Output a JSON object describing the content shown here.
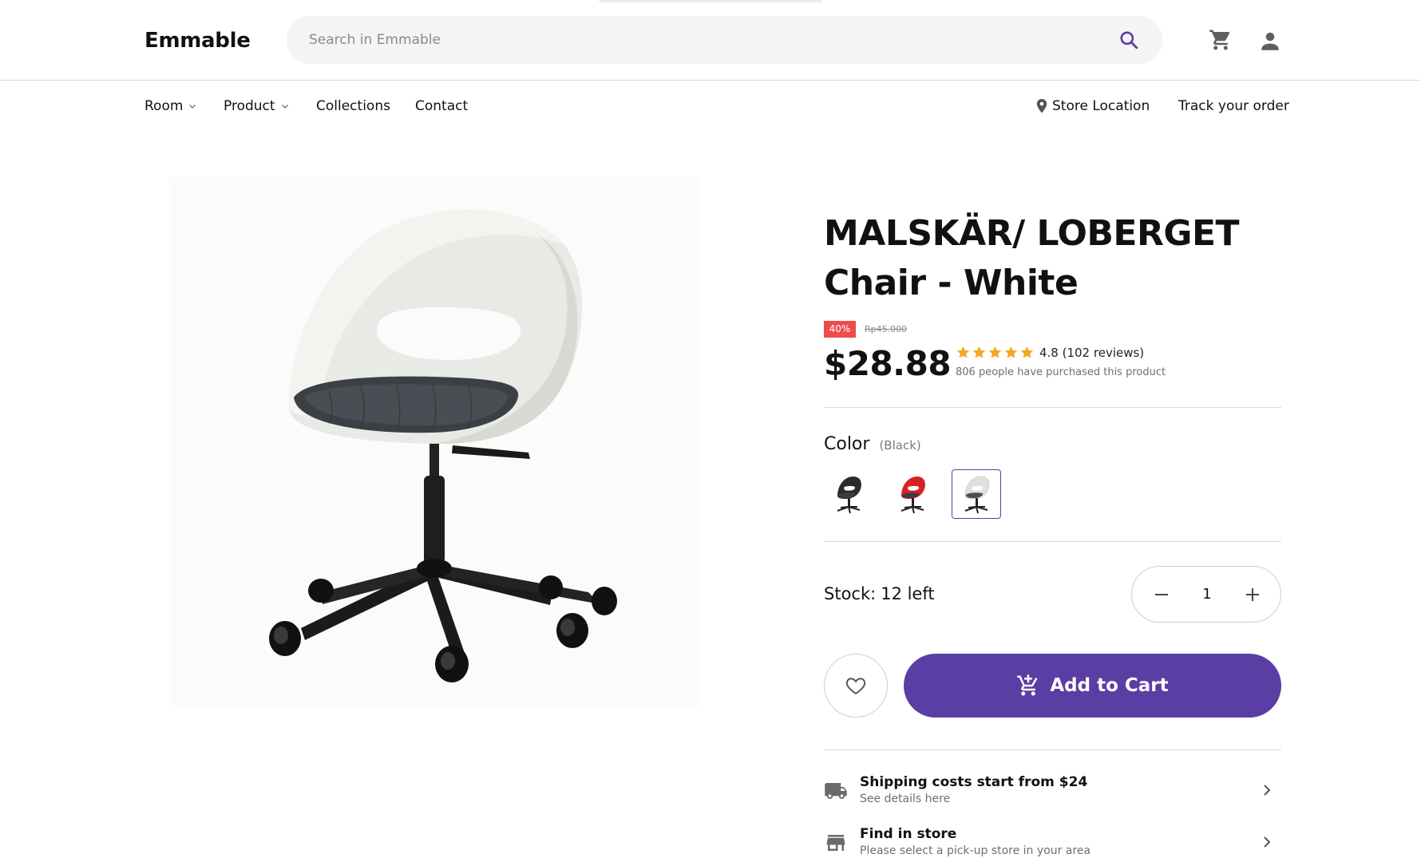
{
  "header": {
    "logo": "Emmable",
    "search_placeholder": "Search in Emmable"
  },
  "nav": {
    "items": [
      {
        "label": "Room",
        "has_dropdown": true
      },
      {
        "label": "Product",
        "has_dropdown": true
      },
      {
        "label": "Collections",
        "has_dropdown": false
      },
      {
        "label": "Contact",
        "has_dropdown": false
      }
    ],
    "store_location": "Store Location",
    "track_order": "Track your order"
  },
  "product": {
    "title": "MALSKÄR/ LOBERGET Chair - White",
    "discount": "40%",
    "old_price": "Rp45.000",
    "price": "$28.88",
    "rating": 4.8,
    "rating_text": "4.8 (102 reviews)",
    "purchased": "806 people have purchased this product",
    "color_label": "Color",
    "color_selected": "(Black)",
    "swatches": [
      {
        "name": "black",
        "color": "#2b2b2b",
        "active": false
      },
      {
        "name": "red",
        "color": "#d42323",
        "active": false
      },
      {
        "name": "white",
        "color": "#e9ebe6",
        "active": true
      }
    ],
    "stock_label": "Stock:",
    "stock_value": "12 left",
    "quantity": "1",
    "add_to_cart": "Add to Cart"
  },
  "info": [
    {
      "title": "Shipping costs start from $24",
      "subtitle": "See details here",
      "icon": "truck-icon"
    },
    {
      "title": "Find in store",
      "subtitle": "Please select a pick-up store in your area",
      "icon": "store-icon"
    }
  ],
  "colors": {
    "accent": "#5b3ea3",
    "discount": "#ee4b4b",
    "star": "#f5a623"
  }
}
